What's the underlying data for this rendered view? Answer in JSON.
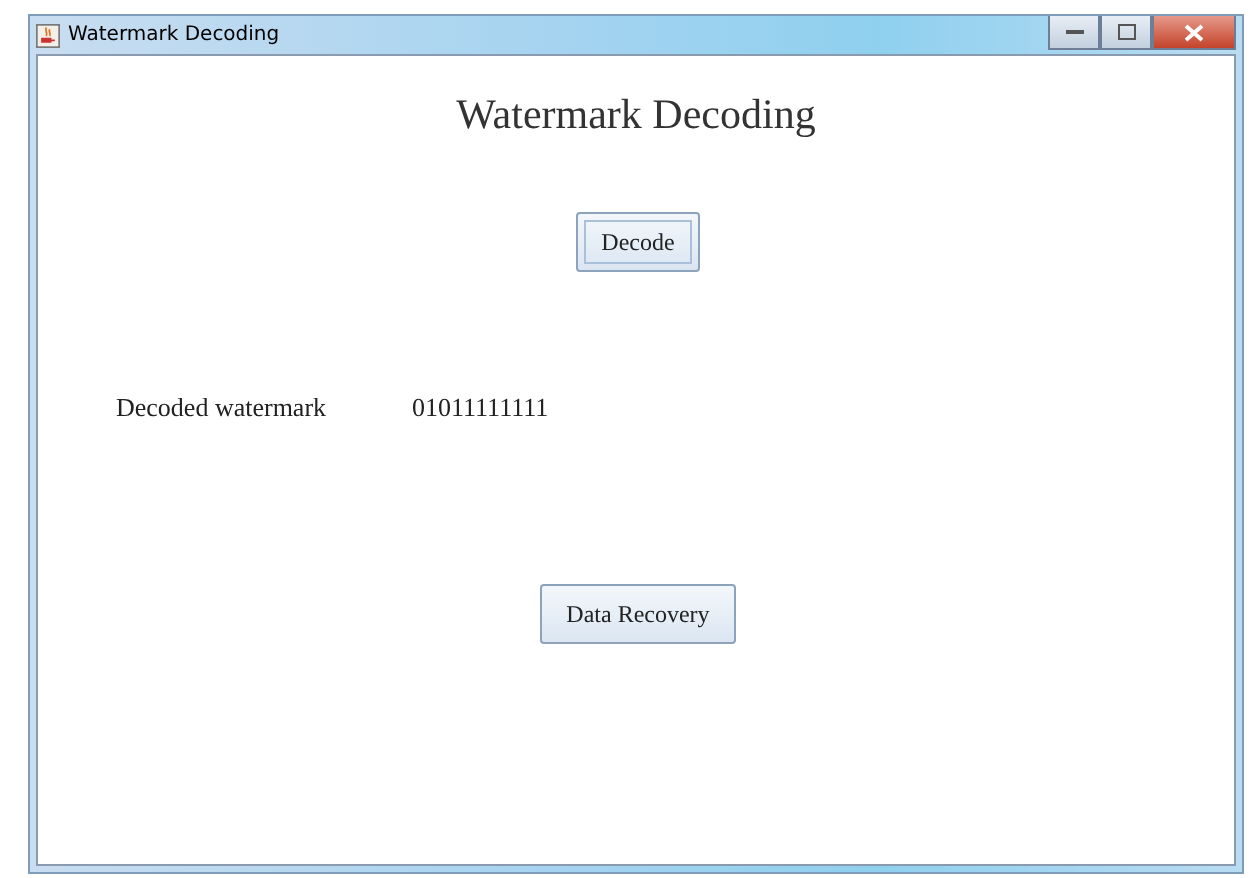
{
  "window": {
    "title": "Watermark Decoding"
  },
  "heading": "Watermark Decoding",
  "decode_button": {
    "label": "Decode",
    "focused": true
  },
  "result": {
    "label": "Decoded watermark",
    "value": "01011111111"
  },
  "recovery_button": {
    "label": "Data Recovery",
    "focused": false
  }
}
